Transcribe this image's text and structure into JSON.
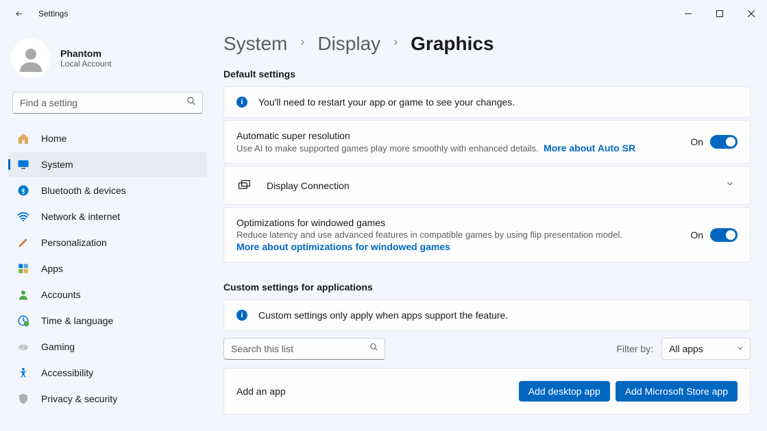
{
  "window": {
    "title": "Settings"
  },
  "user": {
    "name": "Phantom",
    "sub": "Local Account"
  },
  "search": {
    "placeholder": "Find a setting"
  },
  "nav": {
    "items": [
      {
        "label": "Home"
      },
      {
        "label": "System"
      },
      {
        "label": "Bluetooth & devices"
      },
      {
        "label": "Network & internet"
      },
      {
        "label": "Personalization"
      },
      {
        "label": "Apps"
      },
      {
        "label": "Accounts"
      },
      {
        "label": "Time & language"
      },
      {
        "label": "Gaming"
      },
      {
        "label": "Accessibility"
      },
      {
        "label": "Privacy & security"
      }
    ],
    "active_index": 1
  },
  "breadcrumb": {
    "a": "System",
    "b": "Display",
    "c": "Graphics"
  },
  "sections": {
    "default_header": "Default settings",
    "info1": "You'll need to restart your app or game to see your changes.",
    "autosr": {
      "title": "Automatic super resolution",
      "desc": "Use AI to make supported games play more smoothly with enhanced details.",
      "link": "More about Auto SR",
      "state": "On"
    },
    "display_conn": {
      "title": "Display Connection"
    },
    "optim": {
      "title": "Optimizations for windowed games",
      "desc": "Reduce latency and use advanced features in compatible games by using flip presentation model.",
      "link": "More about optimizations for windowed games",
      "state": "On"
    },
    "custom_header": "Custom settings for applications",
    "info2": "Custom settings only apply when apps support the feature.",
    "list_search_placeholder": "Search this list",
    "filter_label": "Filter by:",
    "filter_value": "All apps",
    "add_title": "Add an app",
    "btn_desktop": "Add desktop app",
    "btn_store": "Add Microsoft Store app"
  }
}
